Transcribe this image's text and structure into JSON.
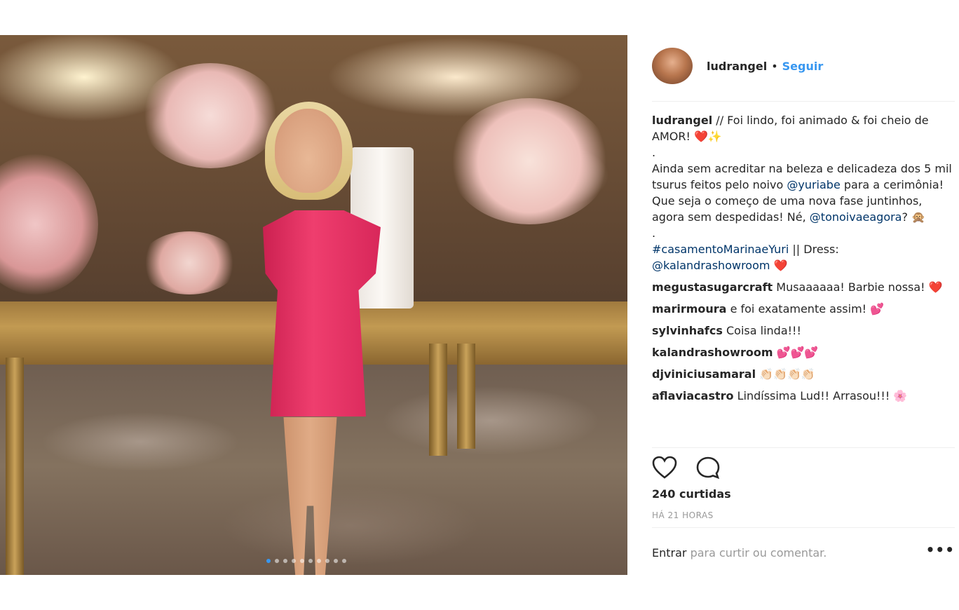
{
  "post": {
    "username": "ludrangel",
    "separator": "•",
    "follow_label": "Seguir",
    "caption_user": "ludrangel",
    "caption_line1": "// Foi lindo, foi animado & foi cheio de AMOR! ❤️✨",
    "caption_dot1": ".",
    "caption_body_a": "Ainda sem acreditar na beleza e delicadeza dos 5 mil tsurus feitos pelo noivo ",
    "mention_1": "@yuriabe",
    "caption_body_b": " para a cerimônia! Que seja o começo de uma nova fase juntinhos, agora sem despedidas! Né, ",
    "mention_2": "@tonoivaeagora",
    "caption_body_c": "? 🙊",
    "caption_dot2": ".",
    "hashtag": "#casamentoMarinaeYuri",
    "dress_text": " || Dress: ",
    "mention_3": "@kalandrashowroom",
    "caption_end": " ❤️",
    "likes": "240 curtidas",
    "time": "HÁ 21 HORAS",
    "login_link": "Entrar",
    "login_rest": " para curtir ou comentar.",
    "more": "•••"
  },
  "comments": [
    {
      "user": "megustasugarcraft",
      "text": " Musaaaaaa! Barbie nossa! ❤️"
    },
    {
      "user": "marirmoura",
      "text": " e foi exatamente assim! 💕"
    },
    {
      "user": "sylvinhafcs",
      "text": " Coisa linda!!!"
    },
    {
      "user": "kalandrashowroom",
      "text": " 💕💕💕"
    },
    {
      "user": "djviniciusamaral",
      "text": " 👏🏻👏🏻👏🏻👏🏻"
    },
    {
      "user": "aflaviacastro",
      "text": " Lindíssima Lud!! Arrasou!!! 🌸"
    }
  ],
  "icons": {
    "like": "heart-icon",
    "comment": "comment-icon",
    "carousel": "carousel-dots",
    "options": "more-options-icon"
  },
  "carousel": {
    "total": 10,
    "active": 1
  },
  "colors": {
    "link": "#003569",
    "follow": "#3897f0",
    "muted": "#999999",
    "text": "#262626"
  }
}
